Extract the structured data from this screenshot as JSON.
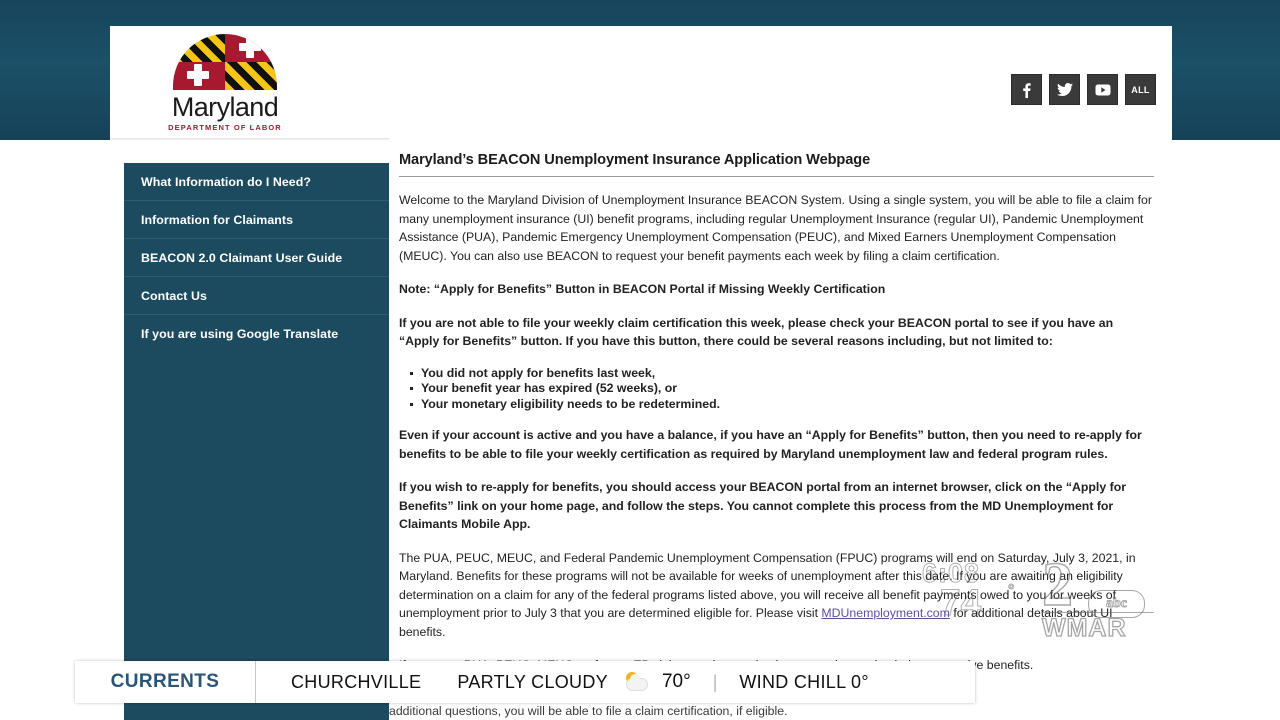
{
  "broadcast": {
    "watermark": {
      "clock": "6:08",
      "temperature": "74",
      "degree": "°",
      "channel_number": "2",
      "network": "abc",
      "callsign": "WMAR"
    },
    "ticker": {
      "brand": "CURRENTS",
      "city": "CHURCHVILLE",
      "condition": "PARTLY CLOUDY",
      "weather_icon": "partly-cloudy-icon",
      "temperature": "70°",
      "separator": "|",
      "wind_chill": "WIND CHILL 0°"
    }
  },
  "site": {
    "logo": {
      "wordmark": "Maryland",
      "subtitle": "DEPARTMENT OF LABOR",
      "flag_gold": "#f5c518",
      "flag_black": "#111111",
      "flag_red": "#a6192e"
    },
    "social": [
      {
        "name": "facebook-icon",
        "label": "f"
      },
      {
        "name": "twitter-icon",
        "label": "t"
      },
      {
        "name": "youtube-icon",
        "label": "y"
      },
      {
        "name": "all-social-button",
        "label": "ALL"
      }
    ],
    "sidebar": {
      "items": [
        {
          "label": "What Information do I Need?"
        },
        {
          "label": "Information for Claimants"
        },
        {
          "label": "BEACON 2.0 Claimant User Guide"
        },
        {
          "label": "Contact Us"
        },
        {
          "label": "If you are using Google Translate"
        }
      ]
    },
    "content": {
      "title": "Maryland’s BEACON Unemployment Insurance Application Webpage",
      "intro": "Welcome to the Maryland Division of Unemployment Insurance BEACON System. Using a single system, you will be able to file a claim for many unemployment insurance (UI) benefit programs, including regular Unemployment Insurance (regular UI), Pandemic Unemployment Assistance (PUA), Pandemic Emergency Unemployment Compensation (PEUC), and Mixed Earners Unemployment Compensation (MEUC). You can also use BEACON to request your benefit payments each week by filing a claim certification.",
      "note_heading": "Note: “Apply for Benefits” Button in BEACON Portal if Missing Weekly Certification",
      "note_body": "If you are not able to file your weekly claim certification this week, please check your BEACON portal to see if you have an “Apply for Benefits” button. If you have this button, there could be several reasons including, but not limited to:",
      "bullets": [
        "You did not apply for benefits last week,",
        "Your benefit year has expired (52 weeks), or",
        "Your monetary eligibility needs to be redetermined."
      ],
      "reapply_note": "Even if your account is active and you have a balance, if you have an “Apply for Benefits” button, then you need to re-apply for benefits to be able to file your weekly certification as required by Maryland unemployment law and federal program rules.",
      "reapply_steps": "If you wish to re-apply for benefits, you should access your BEACON portal from an internet browser, click on the “Apply for Benefits” link on your home page, and follow the steps. You cannot complete this process from the MD Unemployment for Claimants Mobile App.",
      "program_end_pre": "The PUA, PEUC, MEUC, and Federal Pandemic Unemployment Compensation (FPUC) programs will end on Saturday, July 3, 2021, in Maryland. Benefits for these programs will not be available for weeks of unemployment after this date. If you are awaiting an eligibility determination on a claim for any of the federal programs listed above, you will receive all benefit payments owed to you for weeks of unemployment prior to July 3 that you are determined eligible for. Please visit ",
      "program_end_link": "MDUnemployment.com",
      "program_end_post": " for additional details about UI benefits.",
      "final_line": "If you are a PUA, PEUC, MEUC, or former EB claimant, please take the appropriate action below to receive benefits.",
      "clipped_line": "additional questions, you will be able to file a claim certification, if eligible.",
      "link_color": "#5a4fa3"
    }
  }
}
